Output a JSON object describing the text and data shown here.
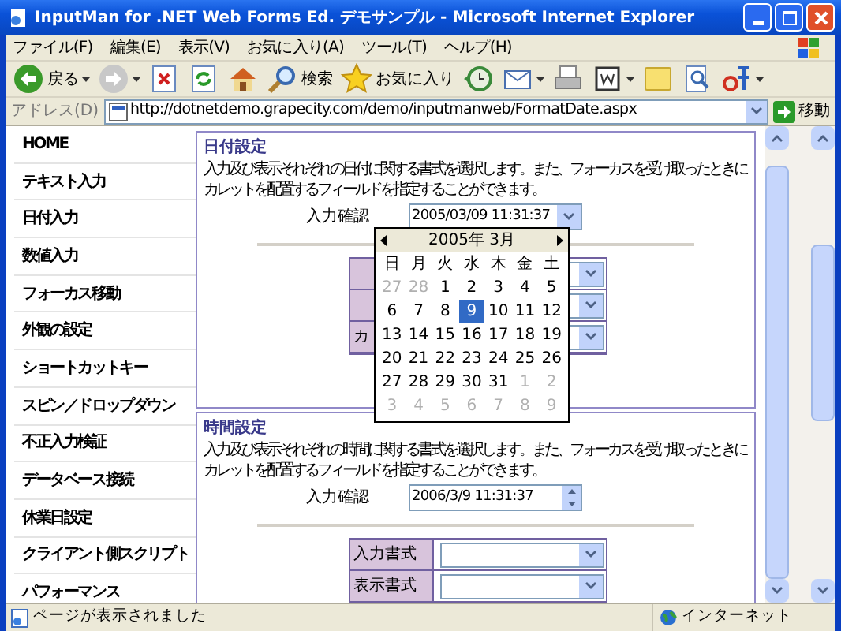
{
  "window": {
    "title": "InputMan for .NET Web Forms Ed. デモサンプル - Microsoft Internet Explorer"
  },
  "menu": [
    "ファイル(F)",
    "編集(E)",
    "表示(V)",
    "お気に入り(A)",
    "ツール(T)",
    "ヘルプ(H)"
  ],
  "toolbar": [
    {
      "kind": "back",
      "label": "戻る",
      "dropdown": true
    },
    {
      "kind": "forward",
      "dropdown": true
    },
    {
      "kind": "stop",
      "dropdown": false
    },
    {
      "kind": "refresh",
      "dropdown": false
    },
    {
      "kind": "home",
      "dropdown": false
    },
    {
      "kind": "search",
      "label": "検索",
      "dropdown": false
    },
    {
      "kind": "favorites",
      "label": "お気に入り",
      "dropdown": false
    },
    {
      "kind": "history",
      "dropdown": false
    },
    {
      "kind": "mail",
      "dropdown": true
    },
    {
      "kind": "print",
      "dropdown": false
    },
    {
      "kind": "word",
      "dropdown": true
    },
    {
      "kind": "note",
      "dropdown": false
    },
    {
      "kind": "research",
      "dropdown": false
    },
    {
      "kind": "translate",
      "dropdown": true
    }
  ],
  "address": {
    "label": "アドレス(D)",
    "url": "http://dotnetdemo.grapecity.com/demo/inputmanweb/FormatDate.aspx",
    "go": "移動"
  },
  "sidebar": {
    "items": [
      "HOME",
      "テキスト入力",
      "日付入力",
      "数値入力",
      "フォーカス移動",
      "外観の設定",
      "ショートカットキー",
      "スピン／ドロップダウン",
      "不正入力検証",
      "データベース接続",
      "休業日設定",
      "クライアント側スクリプト",
      "パフォーマンス"
    ]
  },
  "sections": [
    {
      "title": "日付設定",
      "description": "入力及び表示それぞれの日付に関する書式を選択します。また、フォーカスを受け取ったときにカレットを配置するフィールドを指定することができます。",
      "confirm": {
        "label": "入力確認",
        "value": "2005/03/09 11:31:37",
        "kind": "dropdown"
      },
      "rows": [
        {},
        {},
        {
          "label": "カ"
        }
      ]
    },
    {
      "title": "時間設定",
      "description": "入力及び表示それぞれの時間に関する書式を選択します。また、フォーカスを受け取ったときにカレットを配置するフィールドを指定することができます。",
      "confirm": {
        "label": "入力確認",
        "value": "2006/3/9 11:31:37",
        "kind": "spin"
      },
      "rows": [
        {
          "label": "入力書式"
        },
        {
          "label": "表示書式"
        }
      ]
    }
  ],
  "calendar": {
    "title": "2005年 3月",
    "weekdays": [
      "日",
      "月",
      "火",
      "水",
      "木",
      "金",
      "土"
    ],
    "weeks": [
      [
        {
          "d": "27",
          "muted": true,
          "selected": false
        },
        {
          "d": "28",
          "muted": true,
          "selected": false
        },
        {
          "d": "1",
          "muted": false,
          "selected": false
        },
        {
          "d": "2",
          "muted": false,
          "selected": false
        },
        {
          "d": "3",
          "muted": false,
          "selected": false
        },
        {
          "d": "4",
          "muted": false,
          "selected": false
        },
        {
          "d": "5",
          "muted": false,
          "selected": false
        }
      ],
      [
        {
          "d": "6",
          "muted": false,
          "selected": false
        },
        {
          "d": "7",
          "muted": false,
          "selected": false
        },
        {
          "d": "8",
          "muted": false,
          "selected": false
        },
        {
          "d": "9",
          "muted": false,
          "selected": true
        },
        {
          "d": "10",
          "muted": false,
          "selected": false
        },
        {
          "d": "11",
          "muted": false,
          "selected": false
        },
        {
          "d": "12",
          "muted": false,
          "selected": false
        }
      ],
      [
        {
          "d": "13",
          "muted": false,
          "selected": false
        },
        {
          "d": "14",
          "muted": false,
          "selected": false
        },
        {
          "d": "15",
          "muted": false,
          "selected": false
        },
        {
          "d": "16",
          "muted": false,
          "selected": false
        },
        {
          "d": "17",
          "muted": false,
          "selected": false
        },
        {
          "d": "18",
          "muted": false,
          "selected": false
        },
        {
          "d": "19",
          "muted": false,
          "selected": false
        }
      ],
      [
        {
          "d": "20",
          "muted": false,
          "selected": false
        },
        {
          "d": "21",
          "muted": false,
          "selected": false
        },
        {
          "d": "22",
          "muted": false,
          "selected": false
        },
        {
          "d": "23",
          "muted": false,
          "selected": false
        },
        {
          "d": "24",
          "muted": false,
          "selected": false
        },
        {
          "d": "25",
          "muted": false,
          "selected": false
        },
        {
          "d": "26",
          "muted": false,
          "selected": false
        }
      ],
      [
        {
          "d": "27",
          "muted": false,
          "selected": false
        },
        {
          "d": "28",
          "muted": false,
          "selected": false
        },
        {
          "d": "29",
          "muted": false,
          "selected": false
        },
        {
          "d": "30",
          "muted": false,
          "selected": false
        },
        {
          "d": "31",
          "muted": false,
          "selected": false
        },
        {
          "d": "1",
          "muted": true,
          "selected": false
        },
        {
          "d": "2",
          "muted": true,
          "selected": false
        }
      ],
      [
        {
          "d": "3",
          "muted": true,
          "selected": false
        },
        {
          "d": "4",
          "muted": true,
          "selected": false
        },
        {
          "d": "5",
          "muted": true,
          "selected": false
        },
        {
          "d": "6",
          "muted": true,
          "selected": false
        },
        {
          "d": "7",
          "muted": true,
          "selected": false
        },
        {
          "d": "8",
          "muted": true,
          "selected": false
        },
        {
          "d": "9",
          "muted": true,
          "selected": false
        }
      ]
    ]
  },
  "status": {
    "text": "ページが表示されました",
    "zone": "インターネット"
  }
}
